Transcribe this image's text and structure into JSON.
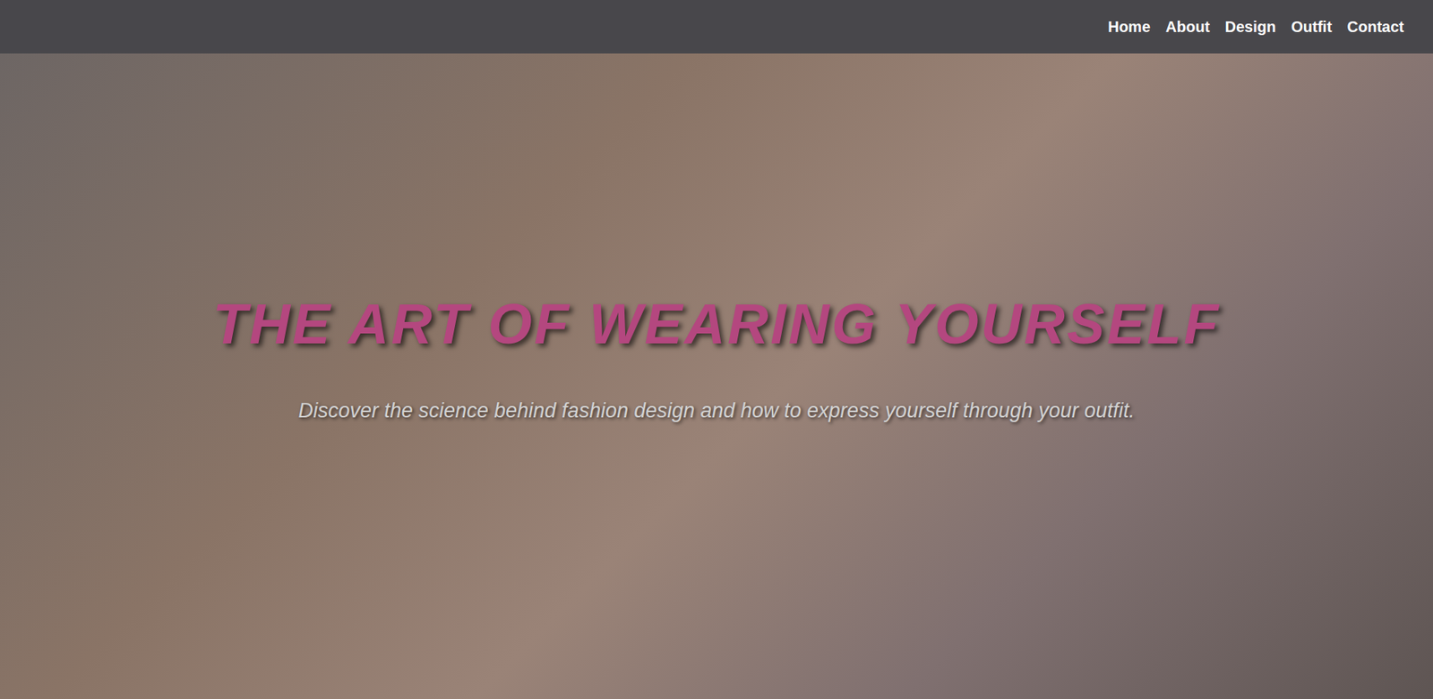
{
  "nav": {
    "items": [
      {
        "label": "Home"
      },
      {
        "label": "About"
      },
      {
        "label": "Design"
      },
      {
        "label": "Outfit"
      },
      {
        "label": "Contact"
      }
    ]
  },
  "hero": {
    "title": "THE ART OF WEARING YOURSELF",
    "subtitle": "Discover the science behind fashion design and how to express yourself through your outfit."
  }
}
